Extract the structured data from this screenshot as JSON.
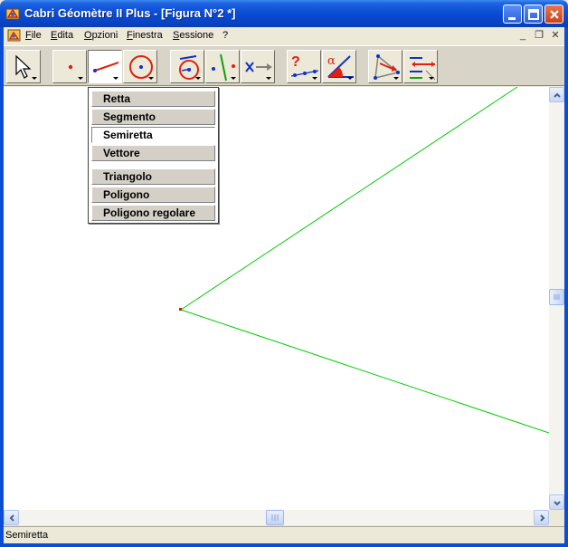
{
  "window": {
    "title": "Cabri Géomètre II Plus - [Figura N°2 *]"
  },
  "menubar": {
    "items": [
      "File",
      "Edita",
      "Opzioni",
      "Finestra",
      "Sessione",
      "?"
    ]
  },
  "toolbar": {
    "tools": [
      {
        "name": "pointer-tool",
        "icon": "arrow-pointer-icon"
      },
      {
        "name": "point-tool",
        "icon": "point-icon"
      },
      {
        "name": "line-tool",
        "icon": "segment-icon",
        "active": true
      },
      {
        "name": "curve-tool",
        "icon": "circle-icon"
      },
      {
        "name": "construct-tool",
        "icon": "compass-icon"
      },
      {
        "name": "transform-tool",
        "icon": "symmetry-icon"
      },
      {
        "name": "macro-tool",
        "icon": "macro-arrow-icon"
      },
      {
        "name": "check-property-tool",
        "icon": "question-collinear-icon"
      },
      {
        "name": "measure-tool",
        "icon": "angle-measure-icon"
      },
      {
        "name": "display-tool",
        "icon": "triangle-label-icon"
      },
      {
        "name": "draw-tool",
        "icon": "marks-icon"
      }
    ]
  },
  "dropdown": {
    "items": [
      {
        "label": "Retta"
      },
      {
        "label": "Segmento"
      },
      {
        "label": "Semiretta",
        "selected": true
      },
      {
        "label": "Vettore"
      },
      {
        "label": "Triangolo"
      },
      {
        "label": "Poligono"
      },
      {
        "label": "Poligono regolare"
      }
    ]
  },
  "colors": {
    "ray": "#00CC00",
    "point": "#CC2200",
    "titlebar": "#0A4ED6"
  },
  "status": {
    "text": "Semiretta"
  }
}
